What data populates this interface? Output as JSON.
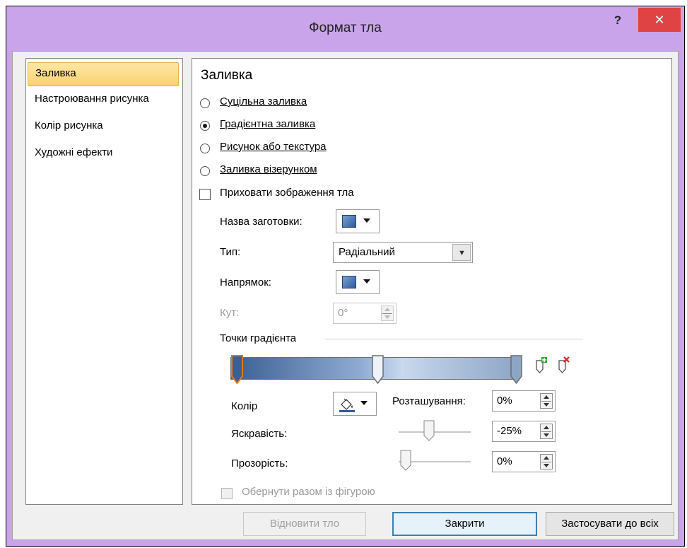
{
  "window": {
    "title": "Формат тла",
    "help": "?",
    "close": "✕"
  },
  "sidebar": {
    "items": [
      {
        "label": "Заливка"
      },
      {
        "label": "Настроювання рисунка"
      },
      {
        "label": "Колір рисунка"
      },
      {
        "label": "Художні ефекти"
      }
    ]
  },
  "panel": {
    "heading": "Заливка",
    "radios": [
      {
        "label": "Суцільна заливка",
        "selected": false
      },
      {
        "label": "Градієнтна заливка",
        "selected": true
      },
      {
        "label": "Рисунок або текстура",
        "selected": false
      },
      {
        "label": "Заливка візерунком",
        "selected": false
      }
    ],
    "hide_bg": {
      "label": "Приховати зображення тла",
      "checked": false
    },
    "preset": {
      "label": "Назва заготовки:"
    },
    "type": {
      "label": "Тип:",
      "value": "Радіальний"
    },
    "direction": {
      "label": "Напрямок:"
    },
    "angle": {
      "label": "Кут:",
      "value": "0°"
    },
    "gradient_stops": {
      "label": "Точки градієнта",
      "positions": [
        0,
        50,
        100
      ],
      "colors": [
        "#3b5f93",
        "#c8d8ee",
        "#8ea6c6"
      ]
    },
    "color": {
      "label": "Колір"
    },
    "position": {
      "label": "Розташування:",
      "value": "0%"
    },
    "brightness": {
      "label": "Яскравість:",
      "value": "-25%"
    },
    "transparency": {
      "label": "Прозорість:",
      "value": "0%"
    },
    "rotate_with_shape": {
      "label": "Обернути разом із фігурою",
      "checked": false,
      "disabled": true
    }
  },
  "footer": {
    "reset": "Відновити тло",
    "close": "Закрити",
    "apply_all": "Застосувати до всіх"
  }
}
